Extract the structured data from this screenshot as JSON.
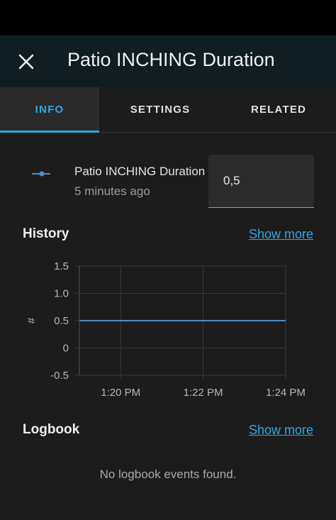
{
  "header": {
    "title": "Patio INCHING Duration",
    "close_icon": "close-icon"
  },
  "tabs": [
    {
      "label": "INFO",
      "active": true
    },
    {
      "label": "SETTINGS",
      "active": false
    },
    {
      "label": "RELATED",
      "active": false
    }
  ],
  "entity": {
    "icon": "ray-vertex-icon",
    "name": "Patio INCHING Duration",
    "last_changed": "5 minutes ago",
    "value": "0,5"
  },
  "history": {
    "title": "History",
    "show_more": "Show more"
  },
  "logbook": {
    "title": "Logbook",
    "show_more": "Show more",
    "empty_text": "No logbook events found."
  },
  "colors": {
    "accent": "#2ea7e0",
    "series": "#4a90c8",
    "background": "#1c1c1c",
    "header_background": "#101e24"
  },
  "chart_data": {
    "type": "line",
    "ylabel": "#",
    "ylim": [
      -0.5,
      1.5
    ],
    "y_ticks": [
      {
        "value": 1.5,
        "label": "1.5"
      },
      {
        "value": 1.0,
        "label": "1.0"
      },
      {
        "value": 0.5,
        "label": "0.5"
      },
      {
        "value": 0,
        "label": "0"
      },
      {
        "value": -0.5,
        "label": "-0.5"
      }
    ],
    "xlim": [
      "13:19",
      "13:24"
    ],
    "x_ticks": [
      {
        "value": "13:20",
        "label": "1:20 PM"
      },
      {
        "value": "13:22",
        "label": "1:22 PM"
      },
      {
        "value": "13:24",
        "label": "1:24 PM"
      }
    ],
    "grid": true,
    "series": [
      {
        "x": [
          "13:19",
          "13:24"
        ],
        "y": [
          0.5,
          0.5
        ]
      }
    ]
  }
}
